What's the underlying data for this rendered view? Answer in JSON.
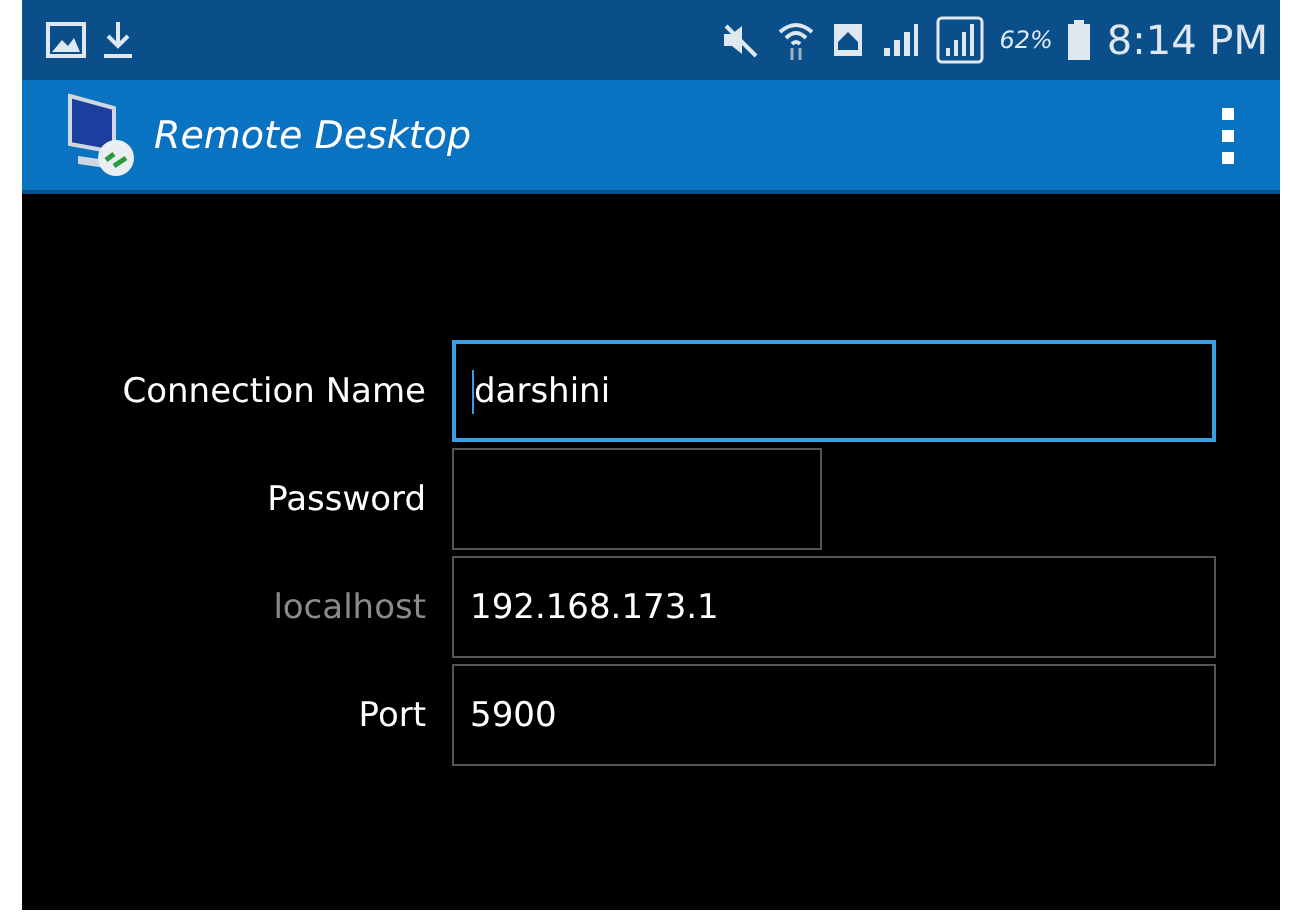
{
  "status_bar": {
    "battery": "62%",
    "time": "8:14 PM"
  },
  "app_bar": {
    "title": "Remote Desktop"
  },
  "form": [
    {
      "kind": "text",
      "label": "Connection Name",
      "value": "darshini",
      "focused": true,
      "dimmed": false
    },
    {
      "kind": "password",
      "label": "Password",
      "focused": false,
      "dimmed": false
    },
    {
      "kind": "text",
      "label": "localhost",
      "value": "192.168.173.1",
      "focused": false,
      "dimmed": true
    },
    {
      "kind": "text",
      "label": "Port",
      "value": "5900",
      "focused": false,
      "dimmed": false
    }
  ]
}
